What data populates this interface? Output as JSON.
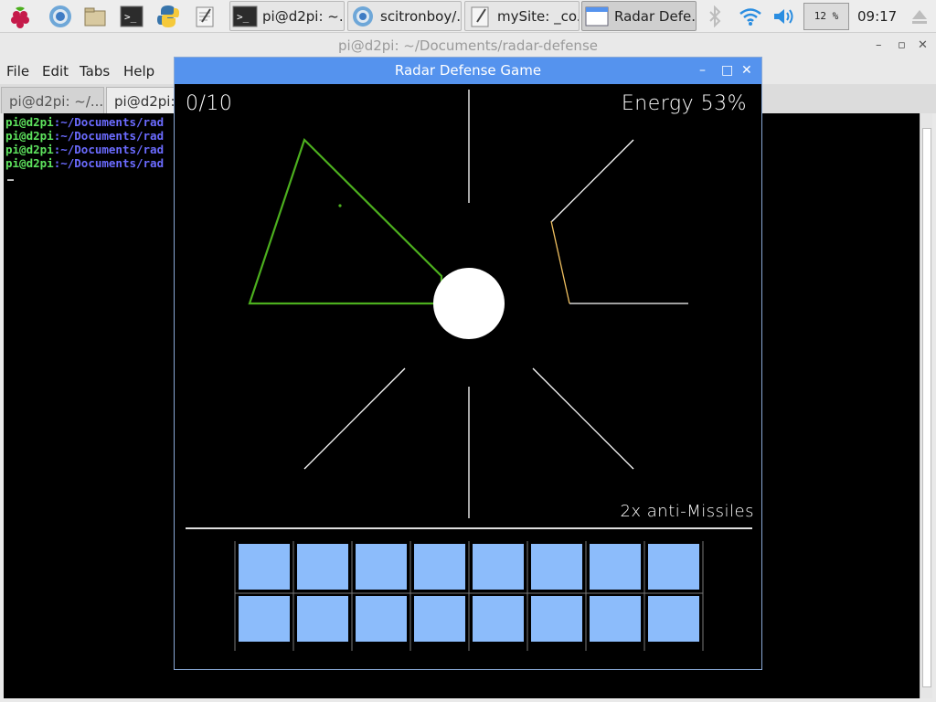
{
  "taskbar": {
    "tasks": [
      {
        "label": "pi@d2pi: ~..."
      },
      {
        "label": "scitronboy/..."
      },
      {
        "label": "mySite: _co..."
      },
      {
        "label": "Radar Defe..."
      }
    ],
    "cpu": "12 %",
    "clock": "09:17"
  },
  "terminal": {
    "title": "pi@d2pi: ~/Documents/radar-defense",
    "menu": [
      "File",
      "Edit",
      "Tabs",
      "Help"
    ],
    "tabs": [
      "pi@d2pi: ~/...",
      "pi@d2pi:"
    ],
    "prompt_user": "pi@d2pi",
    "prompt_path": ":~/Documents/rad",
    "lines": 4
  },
  "game": {
    "title": "Radar Defense Game",
    "score": "0/10",
    "energy": "Energy 53%",
    "antimissiles": "2x anti-Missiles",
    "grid_cols": 8,
    "grid_rows": 2,
    "cell_color": "#8cbcfb",
    "outline_color": "#4caf1e",
    "accent_color": "#f0c060"
  }
}
